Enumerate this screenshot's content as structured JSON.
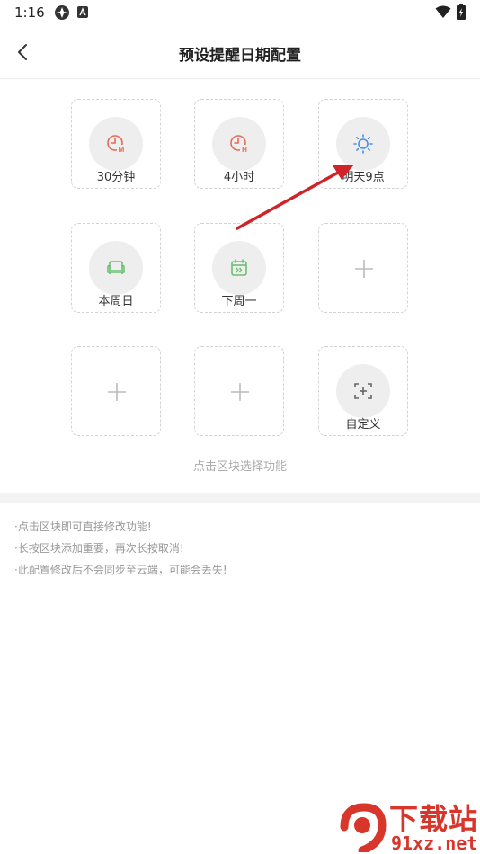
{
  "status_bar": {
    "time": "1:16"
  },
  "header": {
    "title": "预设提醒日期配置"
  },
  "tiles": [
    {
      "label": "30分钟",
      "icon": "clock-m-icon",
      "color": "#e66b57"
    },
    {
      "label": "4小时",
      "icon": "clock-h-icon",
      "color": "#e66b57"
    },
    {
      "label": "明天9点",
      "icon": "sun-icon",
      "color": "#4a90e2"
    },
    {
      "label": "本周日",
      "icon": "sofa-icon",
      "color": "#6cbf72"
    },
    {
      "label": "下周一",
      "icon": "calendar-next-icon",
      "color": "#6cbf72"
    },
    {
      "label": "",
      "icon": "plus-icon"
    },
    {
      "label": "",
      "icon": "plus-icon"
    },
    {
      "label": "",
      "icon": "plus-icon"
    },
    {
      "label": "自定义",
      "icon": "custom-scan-icon",
      "color": "#666666"
    }
  ],
  "hint": "点击区块选择功能",
  "notes": [
    "·点击区块即可直接修改功能!",
    "·长按区块添加重要，再次长按取消!",
    "·此配置修改后不会同步至云端，可能会丢失!"
  ],
  "watermark": {
    "brand": "下载站",
    "site": "91xz.net",
    "accent": "#d8352b"
  }
}
